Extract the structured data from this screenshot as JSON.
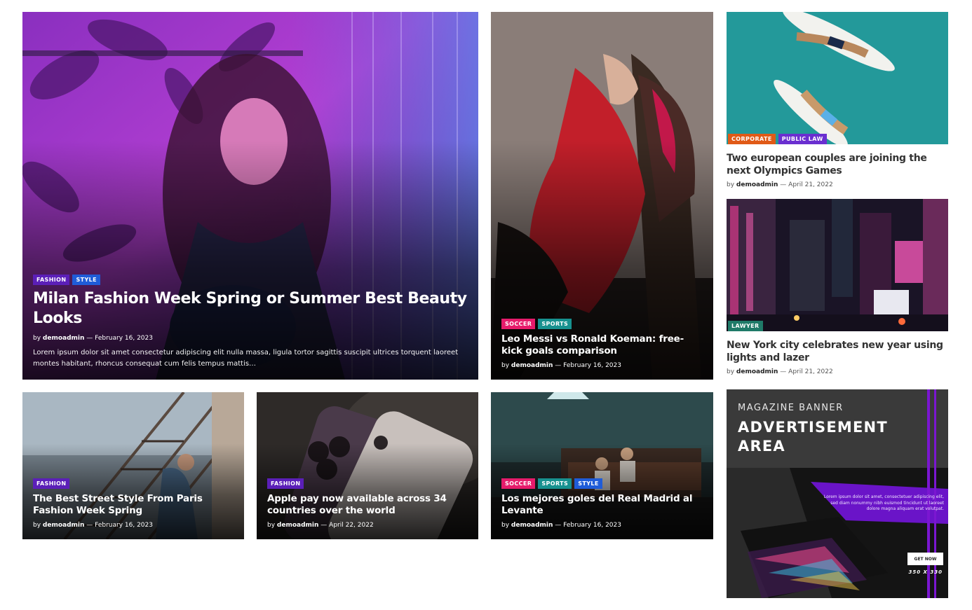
{
  "colors": {
    "fashion": "#5b1fb8",
    "style": "#1f5cd8",
    "soccer": "#e61b6b",
    "sports": "#17918f",
    "corporate": "#e05a17",
    "public_law": "#6a2fd0",
    "lawyer": "#1f7a68",
    "ad_accent": "#7b16d1"
  },
  "featured": {
    "tags": [
      "FASHION",
      "STYLE"
    ],
    "title": "Milan Fashion Week Spring or Summer Best Beauty Looks",
    "by": "by",
    "author": "demoadmin",
    "date": "— February 16, 2023",
    "excerpt": "Lorem ipsum dolor sit amet consectetur adipiscing elit nulla massa, ligula tortor sagittis suscipit ultrices torquent laoreet montes habitant, rhoncus consequat cum felis tempus mattis…"
  },
  "messi": {
    "tags": [
      "SOCCER",
      "SPORTS"
    ],
    "title": "Leo Messi vs Ronald Koeman: free-kick goals comparison",
    "by": "by",
    "author": "demoadmin",
    "date": "— February 16, 2023"
  },
  "street": {
    "tags": [
      "FASHION"
    ],
    "title": "The Best Street Style From Paris Fashion Week Spring",
    "by": "by",
    "author": "demoadmin",
    "date": "— February 16, 2023"
  },
  "apple": {
    "tags": [
      "FASHION"
    ],
    "title": "Apple pay now available across 34 countries over the world",
    "by": "by",
    "author": "demoadmin",
    "date": "— April 22, 2022"
  },
  "madrid": {
    "tags": [
      "SOCCER",
      "SPORTS",
      "STYLE"
    ],
    "title": "Los mejores goles del Real Madrid al Levante",
    "by": "by",
    "author": "demoadmin",
    "date": "— February 16, 2023"
  },
  "olympics": {
    "tags": [
      "CORPORATE",
      "PUBLIC LAW"
    ],
    "title": "Two european couples are joining the next Olympics Games",
    "by": "by",
    "author": "demoadmin",
    "date": "— April 21, 2022"
  },
  "newyork": {
    "tags": [
      "LAWYER"
    ],
    "title": "New York city celebrates new year using lights and lazer",
    "by": "by",
    "author": "demoadmin",
    "date": "— April 21, 2022"
  },
  "ad": {
    "label": "MAGAZINE BANNER",
    "headline_1": "ADVERTISEMENT",
    "headline_2": "AREA",
    "body": "Lorem ipsum dolor sit amet, consectetuer adipiscing elit, sed diam nonummy nibh euismod tincidunt ut laoreet dolore magna aliquam erat volutpat.",
    "button": "GET NOW",
    "size": "350 X 330"
  }
}
